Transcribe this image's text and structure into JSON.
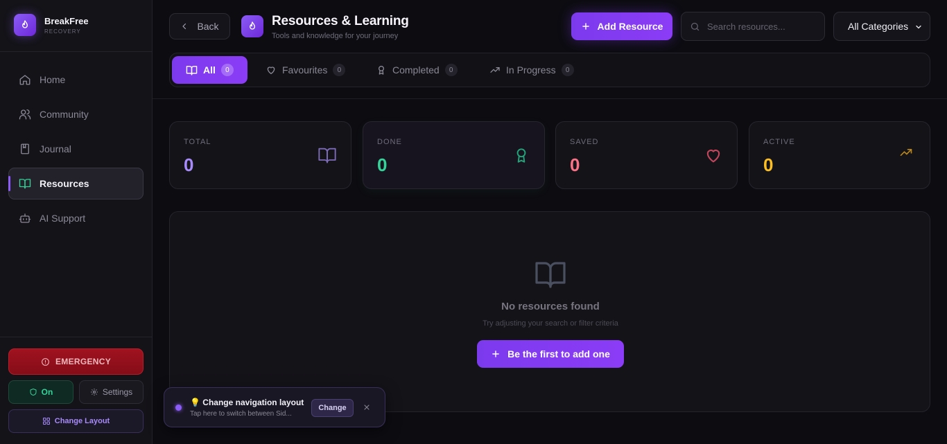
{
  "brand": {
    "name": "BreakFree",
    "subtitle": "RECOVERY"
  },
  "sidebar": {
    "items": [
      {
        "label": "Home",
        "icon": "home-icon",
        "active": false
      },
      {
        "label": "Community",
        "icon": "users-icon",
        "active": false
      },
      {
        "label": "Journal",
        "icon": "notebook-icon",
        "active": false
      },
      {
        "label": "Resources",
        "icon": "book-open-icon",
        "active": true
      },
      {
        "label": "AI Support",
        "icon": "bot-icon",
        "active": false
      }
    ],
    "emergency_label": "EMERGENCY",
    "on_label": "On",
    "settings_label": "Settings",
    "change_layout_label": "Change Layout"
  },
  "header": {
    "back_label": "Back",
    "title": "Resources & Learning",
    "subtitle": "Tools and knowledge for your journey",
    "add_label": "Add Resource",
    "search_placeholder": "Search resources...",
    "category_selected": "All Categories"
  },
  "tabs": [
    {
      "label": "All",
      "count": "0",
      "icon": "book-open-icon",
      "active": true
    },
    {
      "label": "Favourites",
      "count": "0",
      "icon": "heart-icon",
      "active": false
    },
    {
      "label": "Completed",
      "count": "0",
      "icon": "award-icon",
      "active": false
    },
    {
      "label": "In Progress",
      "count": "0",
      "icon": "trending-up-icon",
      "active": false
    }
  ],
  "stats": [
    {
      "label": "TOTAL",
      "value": "0",
      "color": "#a78bfa",
      "icon": "book-open-icon"
    },
    {
      "label": "DONE",
      "value": "0",
      "color": "#34d399",
      "icon": "award-icon"
    },
    {
      "label": "SAVED",
      "value": "0",
      "color": "#fb7185",
      "icon": "heart-icon"
    },
    {
      "label": "ACTIVE",
      "value": "0",
      "color": "#fbbf24",
      "icon": "trending-up-icon"
    }
  ],
  "empty": {
    "title": "No resources found",
    "subtitle": "Try adjusting your search or filter criteria",
    "button_label": "Be the first to add one"
  },
  "toast": {
    "title": "💡 Change navigation layout",
    "subtitle": "Tap here to switch between Sid...",
    "button_label": "Change"
  },
  "colors": {
    "accent": "#8b5cf6",
    "emergency": "#9f1222",
    "success": "#34d399"
  }
}
